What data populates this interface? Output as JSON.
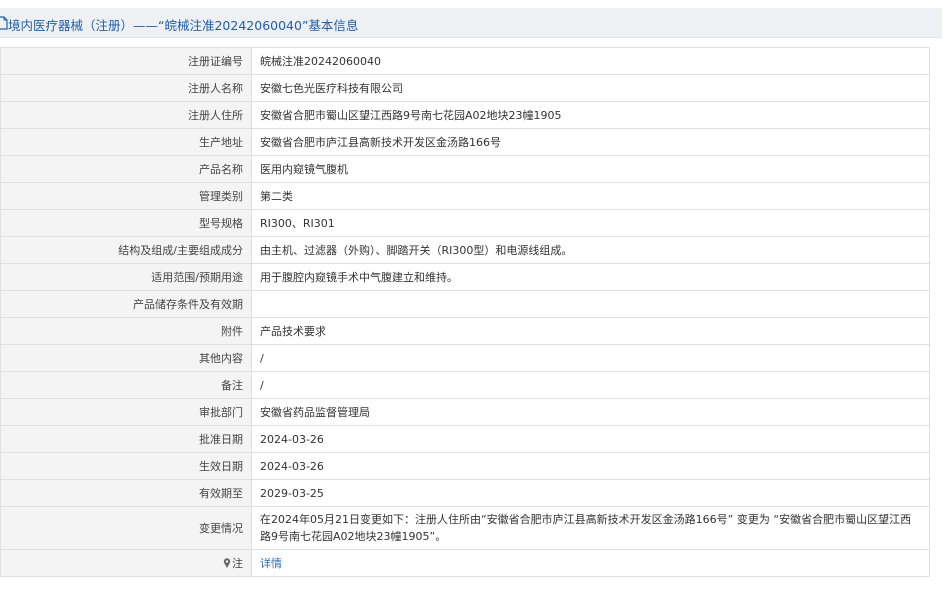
{
  "header": {
    "icon": "document-icon",
    "title": "境内医疗器械（注册）——“皖械注准20242060040”基本信息"
  },
  "rows": [
    {
      "label": "注册证编号",
      "value": "皖械注准20242060040"
    },
    {
      "label": "注册人名称",
      "value": "安徽七色光医疗科技有限公司"
    },
    {
      "label": "注册人住所",
      "value": "安徽省合肥市蜀山区望江西路9号南七花园A02地块23幢1905"
    },
    {
      "label": "生产地址",
      "value": "安徽省合肥市庐江县高新技术开发区金汤路166号"
    },
    {
      "label": "产品名称",
      "value": "医用内窥镜气腹机"
    },
    {
      "label": "管理类别",
      "value": "第二类"
    },
    {
      "label": "型号规格",
      "value": "RI300、RI301"
    },
    {
      "label": "结构及组成/主要组成成分",
      "value": "由主机、过滤器（外购）、脚踏开关（RI300型）和电源线组成。"
    },
    {
      "label": "适用范围/预期用途",
      "value": "用于腹腔内窥镜手术中气腹建立和维持。"
    },
    {
      "label": "产品储存条件及有效期",
      "value": ""
    },
    {
      "label": "附件",
      "value": "产品技术要求"
    },
    {
      "label": "其他内容",
      "value": "/"
    },
    {
      "label": "备注",
      "value": "/"
    },
    {
      "label": "审批部门",
      "value": "安徽省药品监督管理局"
    },
    {
      "label": "批准日期",
      "value": "2024-03-26"
    },
    {
      "label": "生效日期",
      "value": "2024-03-26"
    },
    {
      "label": "有效期至",
      "value": "2029-03-25"
    },
    {
      "label": "变更情况",
      "value": "在2024年05月21日变更如下：注册人住所由“安徽省合肥市庐江县高新技术开发区金汤路166号” 变更为 “安徽省合肥市蜀山区望江西路9号南七花园A02地块23幢1905”。"
    }
  ],
  "note": {
    "icon": "pin-icon",
    "label": "注",
    "link_text": "详情"
  },
  "colors": {
    "accent": "#1f5fa8",
    "link": "#2b6db3",
    "label_bg": "#f4f4f4",
    "header_bg": "#eef0f3",
    "border": "#e0e0e0"
  }
}
